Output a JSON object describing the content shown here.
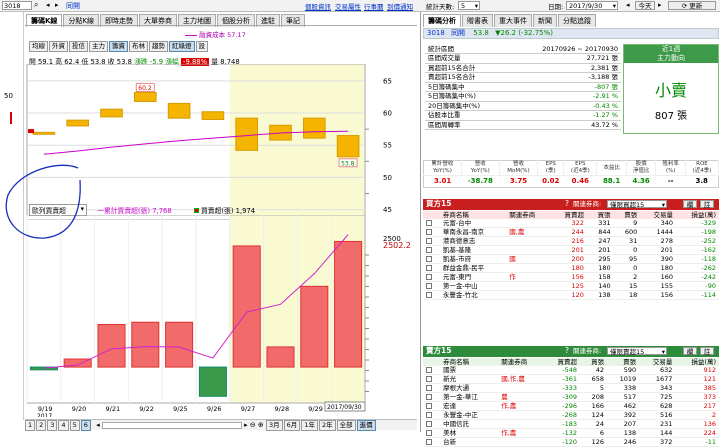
{
  "topbar": {
    "stock_code": "3018",
    "stock_name": "同開",
    "links": [
      "個股資訊",
      "交易屬性",
      "行事曆",
      "到價通知"
    ],
    "stat_days_label": "統計天數:",
    "stat_days_value": "5",
    "date_label": "日期:",
    "date_value": "2017/9/30",
    "today_btn": "今天",
    "refresh_btn": "更新"
  },
  "left": {
    "left_edge_label": "50",
    "tabs": [
      "籌碼K線",
      "分點K線",
      "即時走勢",
      "大單券商",
      "主力地圖",
      "個股分析",
      "進駐",
      "筆記"
    ],
    "active_tab": 0,
    "legend_text": "融資成本 57.17",
    "tool_buttons": [
      "均線",
      "外資",
      "投信",
      "主力",
      "籌資",
      "布林",
      "趨勢",
      "紅綠燈",
      "設"
    ],
    "active_tools": [
      4,
      7
    ],
    "ohlc": {
      "open_label": "開 59.1",
      "high_label": "高 62.4",
      "low_label": "低 53.8",
      "close_label": "收 53.8",
      "chg_label": "漲跌 -5.9",
      "pct_label_prefix": "漲幅",
      "pct_value": "-9.88%",
      "vol_label": "量 8,748"
    },
    "price_axis": [
      "65",
      "60",
      "55",
      "50",
      "45"
    ],
    "price_tag_top": "60.2",
    "price_tag_bottom": "53.8",
    "lower_select": "歐列買賣超",
    "lower_legend1": "一累計買賣超(張) 7,768",
    "lower_legend2": "買賣超(張) 1,974",
    "lower_axis_top": "2500",
    "lower_current": "2502.2",
    "x_labels": [
      "9/19",
      "9/20",
      "9/21",
      "9/22",
      "9/25",
      "9/26",
      "9/27",
      "9/28",
      "9/29"
    ],
    "x_year": "2017",
    "date_box": "2017/09/30",
    "bottom_pages": [
      "1",
      "2",
      "3",
      "4",
      "5",
      "6"
    ],
    "bottom_ranges": [
      "3月",
      "6月",
      "1年",
      "2年",
      "全部",
      "進價"
    ]
  },
  "chart_data": {
    "type": "bar",
    "categories": [
      "9/19",
      "9/20",
      "9/21",
      "9/22",
      "9/25",
      "9/26",
      "9/27",
      "9/28",
      "9/29"
    ],
    "candles": [
      {
        "open": 57.0,
        "close": 56.7
      },
      {
        "open": 58.9,
        "close": 58.0
      },
      {
        "open": 60.6,
        "close": 59.4
      },
      {
        "open": 63.2,
        "close": 61.8
      },
      {
        "open": 61.5,
        "close": 59.2
      },
      {
        "open": 60.2,
        "close": 59.0
      },
      {
        "open": 59.2,
        "close": 54.2
      },
      {
        "open": 58.1,
        "close": 55.8
      },
      {
        "open": 59.2,
        "close": 56.1
      },
      {
        "open": 56.5,
        "close": 53.2
      }
    ],
    "cost_line": [
      53.6,
      54.1,
      54.7,
      55.2,
      55.7,
      56.1,
      56.5,
      56.9,
      57.1,
      57.17
    ],
    "buy_sell": [
      -60,
      180,
      950,
      1000,
      1000,
      -650,
      2700,
      450,
      1800,
      2800
    ],
    "cumulative": [
      -60,
      120,
      1070,
      1200,
      1180,
      530,
      3230,
      3680,
      5480,
      7768
    ],
    "ylim_price": [
      44,
      67
    ],
    "ylim_lower": [
      -800,
      3300
    ]
  },
  "right": {
    "tabs": [
      "籌碼分析",
      "贈書表",
      "重大事件",
      "新聞",
      "分點追蹤"
    ],
    "active_tab": 0,
    "head_code": "3018",
    "head_name": "同開",
    "head_price": "53.8",
    "head_change": "▼26.2 (-32.75%)",
    "stats": [
      {
        "label": "統計區間",
        "value": "20170926 ~ 20170930",
        "cls": ""
      },
      {
        "label": "區間成交量",
        "value": "27,721 張",
        "cls": ""
      },
      {
        "label": "買超前15名合計",
        "value": "2,381 張",
        "cls": ""
      },
      {
        "label": "賣超前15名合計",
        "value": "-3,188 張",
        "cls": ""
      },
      {
        "label": "5日籌碼集中",
        "value": "-807 張",
        "cls": "grn"
      },
      {
        "label": "5日籌碼集中(%)",
        "value": "-2.91 %",
        "cls": "grn"
      },
      {
        "label": "20日籌碼集中(%)",
        "value": "-0.43 %",
        "cls": "grn"
      },
      {
        "label": "佔股本比重",
        "value": "-1.27 %",
        "cls": "grn"
      },
      {
        "label": "區間周轉率",
        "value": "43.72 %",
        "cls": ""
      }
    ],
    "trend_title1": "近1週",
    "trend_title2": "主力動向",
    "trend_value": "小賣",
    "trend_amount": "807 張",
    "fin_headers": [
      "累計營收\nYoY(%)",
      "營收\nYoY(%)",
      "營收\nMoM(%)",
      "EPS\n(季)",
      "EPS\n(近4季)",
      "本益比",
      "股價\n淨值比",
      "殖利率\n(%)",
      "ROE\n(近4季)"
    ],
    "fin_values": [
      "3.01",
      "-38.78",
      "3.75",
      "0.02",
      "0.46",
      "88.1",
      "4.36",
      "--",
      "3.8"
    ],
    "fin_classes": [
      "red",
      "grn",
      "red",
      "red",
      "red",
      "grn",
      "grn",
      "",
      ""
    ],
    "buy_title": "買方15",
    "sell_title": "賣方15",
    "related_label": "關連券商:",
    "related_value": "僅限買超15",
    "related_value2": "僅限賣超15",
    "mini_btn1": "欄",
    "mini_btn2": "註",
    "broker_headers": [
      "券商名稱",
      "關連券商",
      "買賣超",
      "買張",
      "賣張",
      "交易量",
      "損益(萬)"
    ],
    "buy_rows": [
      [
        "元富-台中",
        "",
        "322",
        "331",
        "9",
        "340",
        "-329"
      ],
      [
        "華南永昌-南京",
        "國,農",
        "244",
        "844",
        "600",
        "1444",
        "-198"
      ],
      [
        "港商德意志",
        "",
        "216",
        "247",
        "31",
        "278",
        "-252"
      ],
      [
        "凱基-基隆",
        "",
        "201",
        "201",
        "0",
        "201",
        "-162"
      ],
      [
        "凱基-市府",
        "國",
        "200",
        "295",
        "95",
        "390",
        "-118"
      ],
      [
        "群益金鼎-民平",
        "",
        "180",
        "180",
        "0",
        "180",
        "-262"
      ],
      [
        "元富-東門",
        "作",
        "156",
        "158",
        "2",
        "160",
        "-242"
      ],
      [
        "第一金-中山",
        "",
        "125",
        "140",
        "15",
        "155",
        "-90"
      ],
      [
        "永豐金-竹北",
        "",
        "120",
        "138",
        "18",
        "156",
        "-114"
      ]
    ],
    "sell_rows": [
      [
        "國票",
        "",
        "-548",
        "42",
        "590",
        "632",
        "912"
      ],
      [
        "新光",
        "國,作,農",
        "-361",
        "658",
        "1019",
        "1677",
        "121"
      ],
      [
        "摩根大通",
        "",
        "-333",
        "5",
        "338",
        "343",
        "385"
      ],
      [
        "第一金-華江",
        "農",
        "-309",
        "208",
        "517",
        "725",
        "373"
      ],
      [
        "宏達",
        "作,農",
        "-296",
        "166",
        "462",
        "628",
        "217"
      ],
      [
        "永豐金-中正",
        "",
        "-268",
        "124",
        "392",
        "516",
        "2"
      ],
      [
        "中國信託",
        "",
        "-183",
        "24",
        "207",
        "231",
        "136"
      ],
      [
        "美林",
        "作,農",
        "-132",
        "6",
        "138",
        "144",
        "224"
      ],
      [
        "台新",
        "",
        "-120",
        "126",
        "246",
        "372",
        "-11"
      ]
    ]
  }
}
